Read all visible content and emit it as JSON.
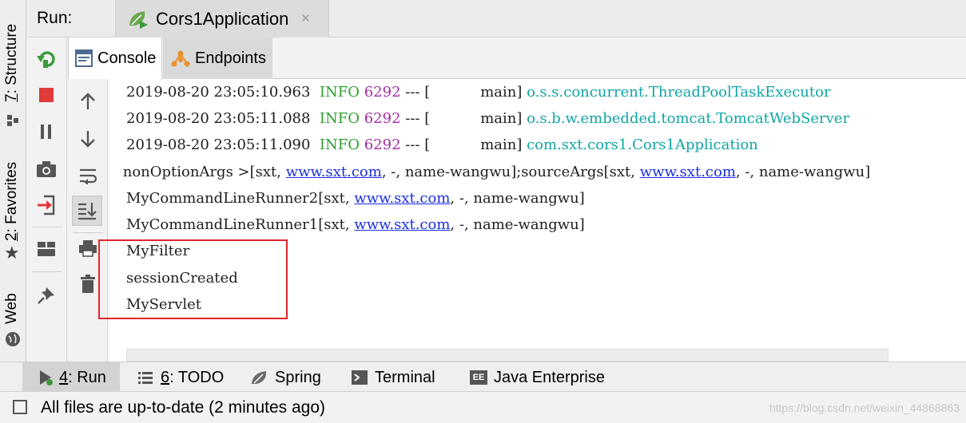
{
  "left_strip": {
    "structure_num": "7",
    "structure_label": ": Structure",
    "favorites_num": "2",
    "favorites_label": ": Favorites",
    "web_label": "Web"
  },
  "run": {
    "label": "Run:",
    "tab_title": "Cors1Application",
    "close_glyph": "×"
  },
  "subtabs": {
    "console": "Console",
    "endpoints": "Endpoints"
  },
  "console": {
    "log_lines": [
      {
        "ts": "2019-08-20 23:05:10.963",
        "level": "INFO",
        "pid": "6292",
        "sep": " --- [           main] ",
        "cls": "o.s.s.concurrent.ThreadPoolTaskExecutor"
      },
      {
        "ts": "2019-08-20 23:05:11.088",
        "level": "INFO",
        "pid": "6292",
        "sep": " --- [           main] ",
        "cls": "o.s.b.w.embedded.tomcat.TomcatWebServer"
      },
      {
        "ts": "2019-08-20 23:05:11.090",
        "level": "INFO",
        "pid": "6292",
        "sep": " --- [           main] ",
        "cls": "com.sxt.cors1.Cors1Application"
      }
    ],
    "args_line": {
      "p1": " nonOptionArgs >[sxt, ",
      "link1": "www.sxt.com",
      "p2": ", -, name-wangwu];sourceArgs[sxt, ",
      "link2": "www.sxt.com",
      "p3": ", -, name-wangwu]"
    },
    "runner2": {
      "p1": "MyCommandLineRunner2[sxt, ",
      "link": "www.sxt.com",
      "p2": ", -, name-wangwu]"
    },
    "runner1": {
      "p1": "MyCommandLineRunner1[sxt, ",
      "link": "www.sxt.com",
      "p2": ", -, name-wangwu]"
    },
    "plain_lines": [
      "MyFilter",
      "sessionCreated",
      "MyServlet"
    ]
  },
  "bottom_tabs": {
    "run_num": "4",
    "run_label": ": Run",
    "todo_num": "6",
    "todo_label": ": TODO",
    "spring": "Spring",
    "terminal": "Terminal",
    "java_ee": "Java Enterprise"
  },
  "status": {
    "text": "All files are up-to-date (2 minutes ago)",
    "watermark": "https://blog.csdn.net/weixin_44868863"
  },
  "colors": {
    "info": "#2f9f2f",
    "pid": "#a52ea5",
    "class_name": "#11a5a5",
    "link": "#1b2fe0",
    "highlight": "#e0262a"
  }
}
